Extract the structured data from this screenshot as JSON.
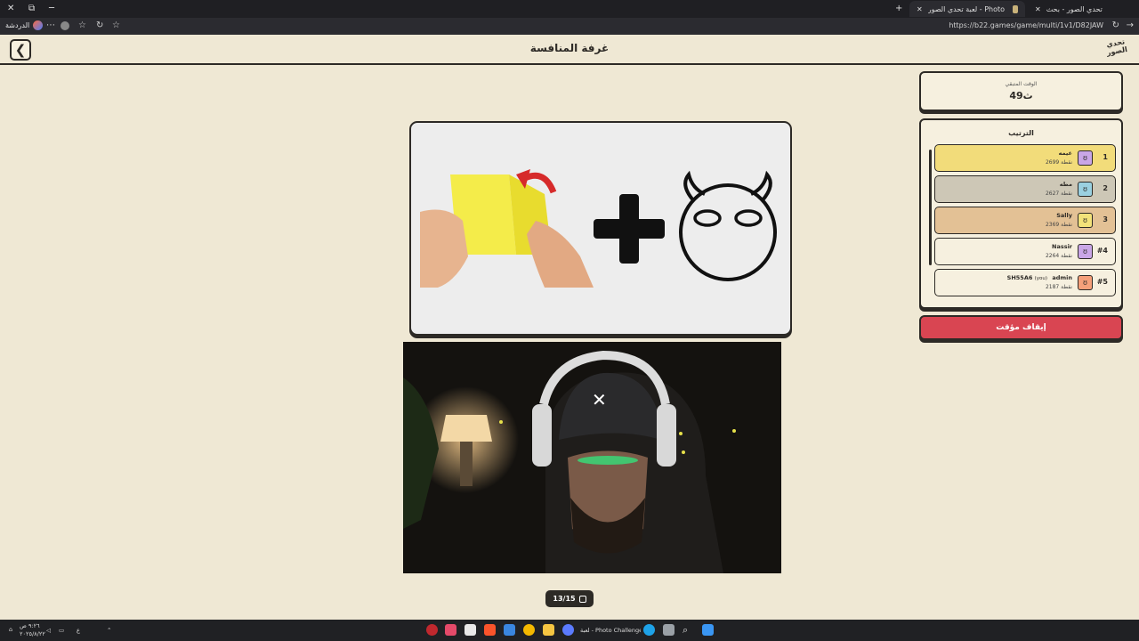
{
  "browser": {
    "tabs": [
      {
        "title": "تحدي الصور - بحث",
        "active": false
      },
      {
        "title": "لعبة تحدي الصور - Photo Challenge",
        "active": true
      }
    ],
    "url": "https://b22.games/game/multi/1v1/D82JAW",
    "shortcut_label": "الدردشة"
  },
  "header": {
    "title": "غرفة المنافسة",
    "logo_text": "تحدي الصور",
    "back_icon": "chevron-left-icon"
  },
  "timer": {
    "label": "الوقت المتبقي",
    "value": "49ث"
  },
  "ranking": {
    "title": "الترتيب",
    "players": [
      {
        "rank": "1",
        "name": "غيمه",
        "points": "2699 نقطة",
        "color": "#f2dc7a",
        "avatar_color": "#c9a6e6"
      },
      {
        "rank": "2",
        "name": "مطه",
        "points": "2627 نقطة",
        "color": "#cdc7b6",
        "avatar_color": "#9ad0e0"
      },
      {
        "rank": "3",
        "name": "Sally",
        "points": "2369 نقطة",
        "color": "#e3c195",
        "avatar_color": "#f2e27a"
      },
      {
        "rank": "#4",
        "name": "Nassir",
        "points": "2264 نقطة",
        "color": "#f6f0df",
        "avatar_color": "#c9a6e6"
      },
      {
        "rank": "#5",
        "name": "SH55A6",
        "name_prefix": "admin",
        "you_label": "(you)",
        "points": "2187 نقطة",
        "color": "#f6f0df",
        "avatar_color": "#f5a07a"
      }
    ]
  },
  "pause_button": {
    "label": "إيقاف مؤقت"
  },
  "puzzle": {
    "description_icons": [
      "paper-fold-icon",
      "plus-icon",
      "devil-face-icon"
    ]
  },
  "counter": {
    "value": "13/15"
  },
  "taskbar": {
    "active_window": "لعبة - Photo Challenge",
    "clock_line1": "٩:٢٦ ص",
    "clock_line2": "٢٠٢٥/٨/٢٢",
    "lang": "ع"
  },
  "colors": {
    "background": "#efe8d4",
    "ink": "#2d2a26",
    "pause_red": "#d94552"
  }
}
